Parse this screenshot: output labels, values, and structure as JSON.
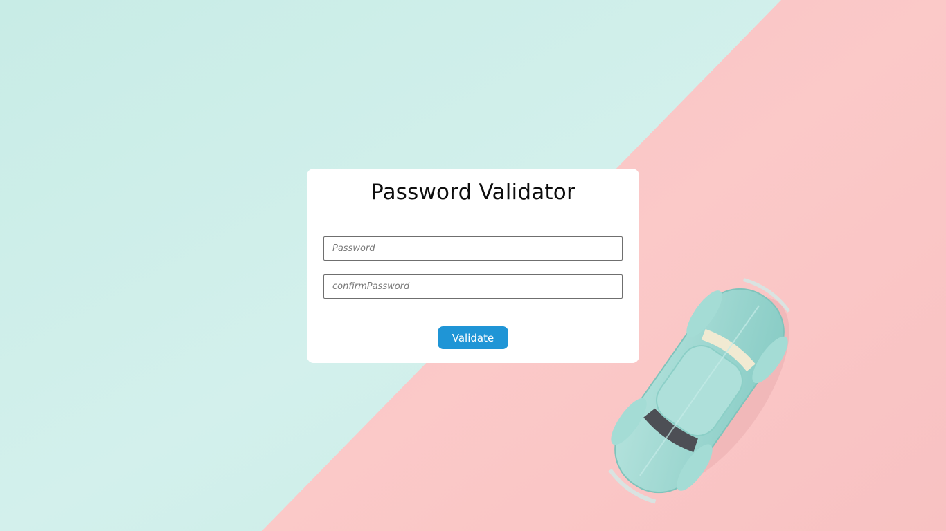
{
  "page": {
    "title": "Password Validator"
  },
  "form": {
    "password": {
      "value": "",
      "placeholder": "Password"
    },
    "confirm_password": {
      "value": "",
      "placeholder": "confirmPassword"
    },
    "submit_label": "Validate"
  },
  "background": {
    "left_color": "#cdeee8",
    "right_color": "#f8c3c3",
    "object_icon": "toy-car-icon",
    "car_color": "#9fd8d2"
  },
  "colors": {
    "card": "#ffffff",
    "button": "#1f95d6",
    "button_text": "#ffffff",
    "title": "#0d0d0d"
  }
}
